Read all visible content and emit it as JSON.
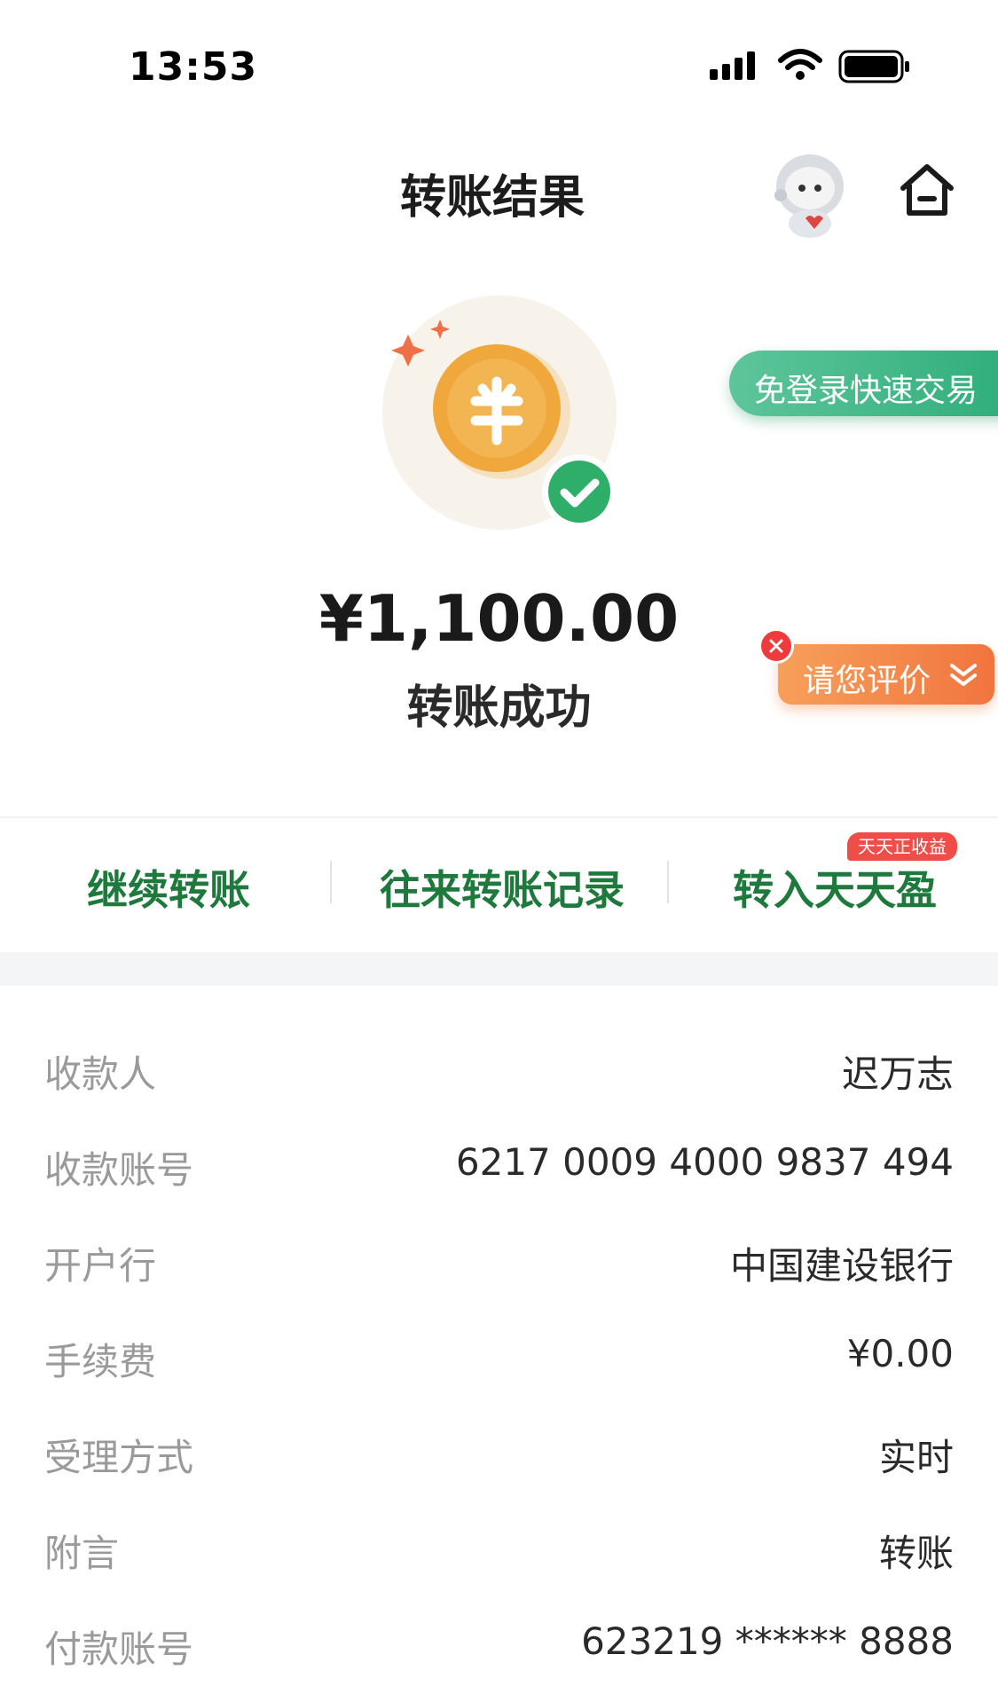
{
  "status_bar": {
    "time": "13:53",
    "icons": [
      "signal-icon",
      "wifi-icon",
      "battery-icon"
    ]
  },
  "header": {
    "title": "转账结果",
    "icons": [
      "mascot-avatar",
      "home-icon"
    ]
  },
  "result": {
    "amount": "¥1,100.00",
    "status": "转账成功",
    "icons": [
      "coin-icon",
      "success-check-icon",
      "sparkle-icon"
    ]
  },
  "floating": {
    "quick_trade": "免登录快速交易",
    "rate": "请您评价"
  },
  "actions": {
    "continue": "继续转账",
    "history": "往来转账记录",
    "transfer_in": "转入天天盈",
    "promo_badge": "天天正收益"
  },
  "details": [
    {
      "label": "收款人",
      "value": "迟万志"
    },
    {
      "label": "收款账号",
      "value": "6217 0009 4000 9837 494"
    },
    {
      "label": "开户行",
      "value": "中国建设银行"
    },
    {
      "label": "手续费",
      "value": "¥0.00"
    },
    {
      "label": "受理方式",
      "value": "实时"
    },
    {
      "label": "附言",
      "value": "转账"
    },
    {
      "label": "付款账号",
      "value": "623219 ****** 8888"
    }
  ],
  "colors": {
    "brand_green": "#1e7a3c",
    "success_green": "#2fae6a",
    "coin_orange": "#f0a83c",
    "promo_red": "#ee4e47",
    "rate_orange": "#f2743f"
  }
}
